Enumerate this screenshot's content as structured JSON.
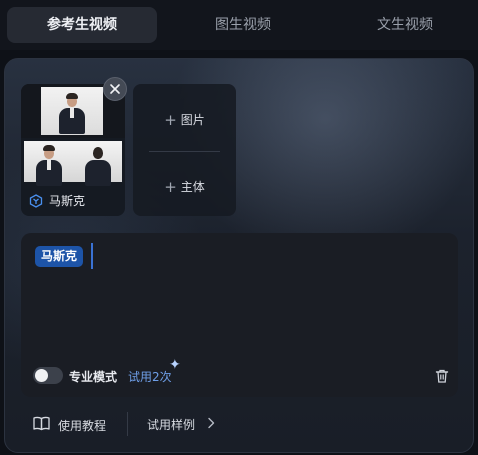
{
  "tabs": [
    {
      "label": "参考生视频",
      "active": true
    },
    {
      "label": "图生视频",
      "active": false
    },
    {
      "label": "文生视频",
      "active": false
    }
  ],
  "reference": {
    "subject_name": "马斯克",
    "icons": {
      "remove": "close-icon",
      "subject": "subject-cube-icon"
    }
  },
  "add_panel": {
    "image_label": "图片",
    "subject_label": "主体",
    "icon": "plus-icon"
  },
  "editor": {
    "mention_chip": "马斯克",
    "pro_mode_label": "专业模式",
    "pro_mode_enabled": false,
    "trial_text": "试用2次",
    "icons": {
      "sparkle": "sparkle-icon",
      "delete": "trash-icon"
    }
  },
  "footer": {
    "tutorial_label": "使用教程",
    "examples_label": "试用样例",
    "icons": {
      "tutorial": "book-icon",
      "examples": "chevron-right-icon"
    }
  },
  "colors": {
    "accent_blue": "#1d54a8",
    "link_blue": "#6f9fe8",
    "active_tab_bg": "#262a33"
  }
}
